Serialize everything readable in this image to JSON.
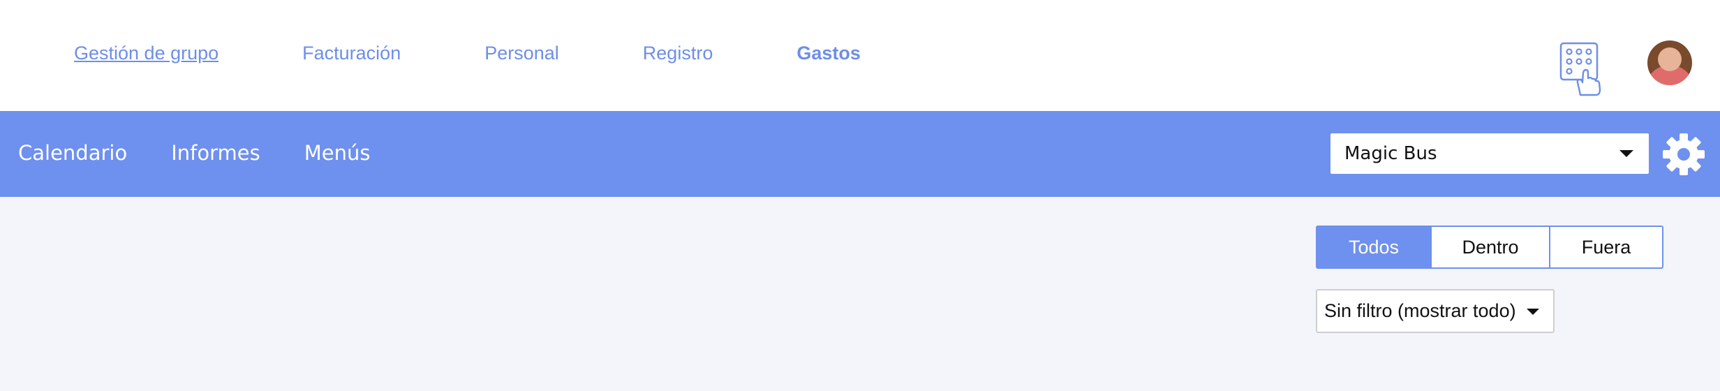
{
  "top_nav": {
    "items": [
      {
        "label": "Gestión de grupo"
      },
      {
        "label": "Facturación"
      },
      {
        "label": "Personal"
      },
      {
        "label": "Registro"
      },
      {
        "label": "Gastos"
      }
    ],
    "active": "Gastos"
  },
  "icons": {
    "keypad": "keypad-touch-icon",
    "avatar": "user-avatar",
    "settings": "gear-icon",
    "dropdown": "chevron-down-icon"
  },
  "sub_nav": {
    "items": [
      {
        "label": "Calendario"
      },
      {
        "label": "Informes"
      },
      {
        "label": "Menús"
      }
    ],
    "group_select": {
      "value": "Magic Bus"
    }
  },
  "content": {
    "segment": {
      "options": [
        {
          "label": "Todos"
        },
        {
          "label": "Dentro"
        },
        {
          "label": "Fuera"
        }
      ],
      "selected": "Todos"
    },
    "filter_select": {
      "value": "Sin filtro (mostrar todo)"
    }
  },
  "colors": {
    "accent": "#6e90ee",
    "link": "#6e8ee8",
    "background": "#f4f5fa"
  }
}
